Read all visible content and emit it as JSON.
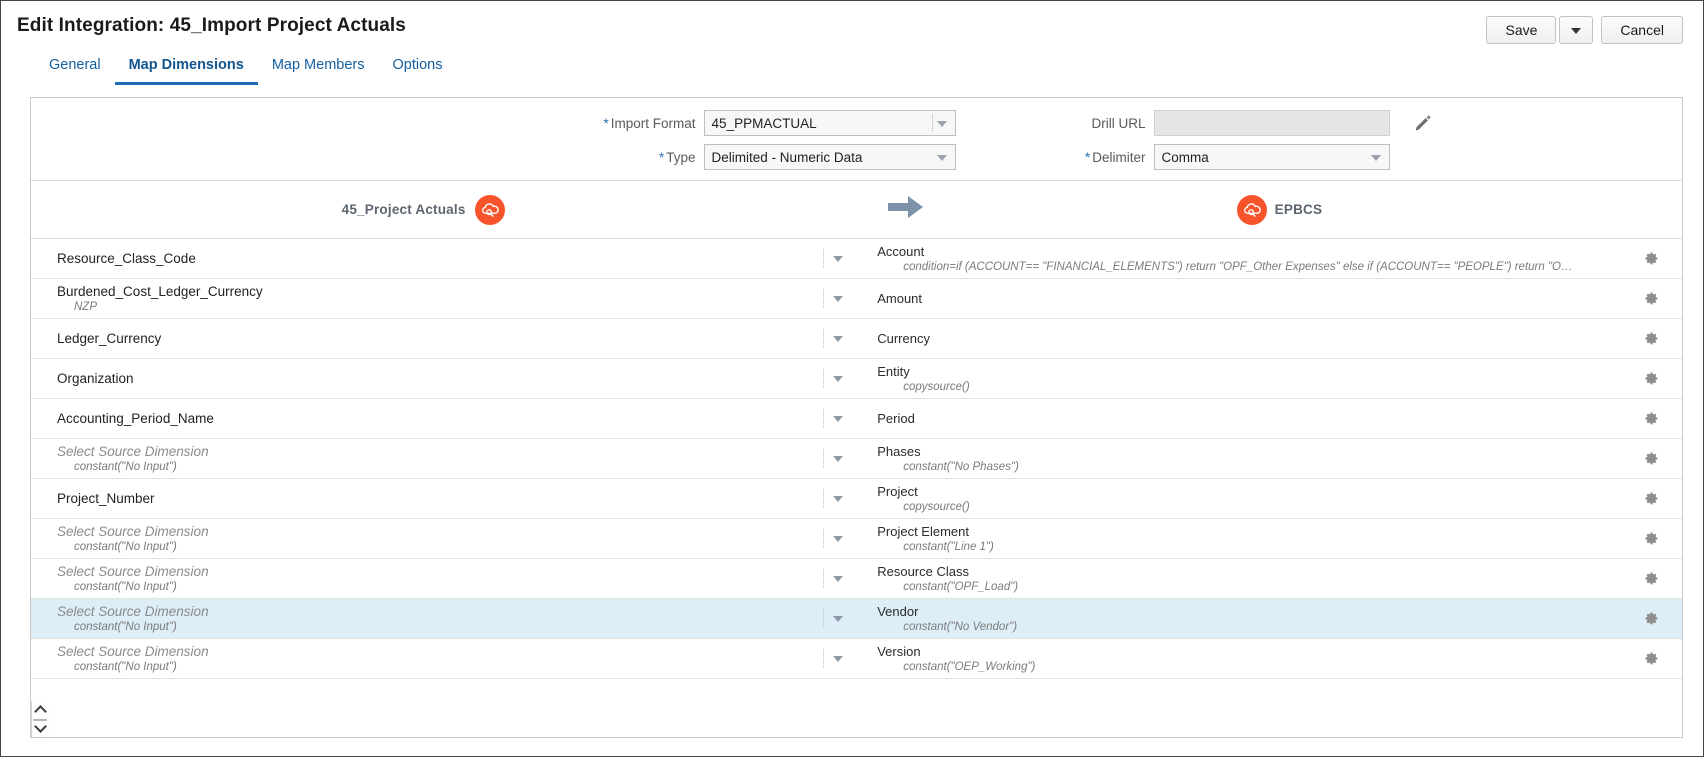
{
  "header": {
    "title": "Edit Integration: 45_Import Project Actuals",
    "save_label": "Save",
    "cancel_label": "Cancel"
  },
  "tabs": [
    {
      "label": "General",
      "active": false
    },
    {
      "label": "Map Dimensions",
      "active": true
    },
    {
      "label": "Map Members",
      "active": false
    },
    {
      "label": "Options",
      "active": false
    }
  ],
  "form": {
    "import_format": {
      "label": "Import Format",
      "required": true,
      "value": "45_PPMACTUAL"
    },
    "type": {
      "label": "Type",
      "required": true,
      "value": "Delimited - Numeric Data"
    },
    "drill_url": {
      "label": "Drill URL",
      "required": false,
      "value": "",
      "disabled": true,
      "edit_icon": "pencil-icon"
    },
    "delimiter": {
      "label": "Delimiter",
      "required": true,
      "value": "Comma"
    }
  },
  "endpoints": {
    "source_name": "45_Project Actuals",
    "source_icon": "cloud-source-icon",
    "flow_icon": "arrow-right-icon",
    "target_name": "EPBCS",
    "target_icon": "cloud-target-icon"
  },
  "mapping": {
    "source_placeholder": "Select Source Dimension",
    "row_menu_icon": "gear-icon",
    "row_dropdown_icon": "chevron-down-icon",
    "rows": [
      {
        "source": "Resource_Class_Code",
        "source_is_placeholder": false,
        "source_sub": "",
        "target": "Account",
        "target_sub": "condition=if (ACCOUNT== \"FINANCIAL_ELEMENTS\") return \"OPF_Other Expenses\" else if (ACCOUNT== \"PEOPLE\") return \"OPF_Labor Ex...",
        "selected": false
      },
      {
        "source": "Burdened_Cost_Ledger_Currency",
        "source_is_placeholder": false,
        "source_sub": "NZP",
        "target": "Amount",
        "target_sub": "",
        "selected": false
      },
      {
        "source": "Ledger_Currency",
        "source_is_placeholder": false,
        "source_sub": "",
        "target": "Currency",
        "target_sub": "",
        "selected": false
      },
      {
        "source": "Organization",
        "source_is_placeholder": false,
        "source_sub": "",
        "target": "Entity",
        "target_sub": "copysource()",
        "selected": false
      },
      {
        "source": "Accounting_Period_Name",
        "source_is_placeholder": false,
        "source_sub": "",
        "target": "Period",
        "target_sub": "",
        "selected": false
      },
      {
        "source": "Select Source Dimension",
        "source_is_placeholder": true,
        "source_sub": "constant(\"No Input\")",
        "target": "Phases",
        "target_sub": "constant(\"No Phases\")",
        "selected": false
      },
      {
        "source": "Project_Number",
        "source_is_placeholder": false,
        "source_sub": "",
        "target": "Project",
        "target_sub": "copysource()",
        "selected": false
      },
      {
        "source": "Select Source Dimension",
        "source_is_placeholder": true,
        "source_sub": "constant(\"No Input\")",
        "target": "Project Element",
        "target_sub": "constant(\"Line 1\")",
        "selected": false
      },
      {
        "source": "Select Source Dimension",
        "source_is_placeholder": true,
        "source_sub": "constant(\"No Input\")",
        "target": "Resource Class",
        "target_sub": "constant(\"OPF_Load\")",
        "selected": false
      },
      {
        "source": "Select Source Dimension",
        "source_is_placeholder": true,
        "source_sub": "constant(\"No Input\")",
        "target": "Vendor",
        "target_sub": "constant(\"No Vendor\")",
        "selected": true
      },
      {
        "source": "Select Source Dimension",
        "source_is_placeholder": true,
        "source_sub": "constant(\"No Input\")",
        "target": "Version",
        "target_sub": "constant(\"OEP_Working\")",
        "selected": false
      }
    ]
  },
  "colors": {
    "accent": "#1560a0",
    "tab_active_underline": "#1b6cb0",
    "cloud_badge": "#f8542c",
    "flow_arrow": "#7b92a8",
    "row_selected": "#ddeef8"
  }
}
